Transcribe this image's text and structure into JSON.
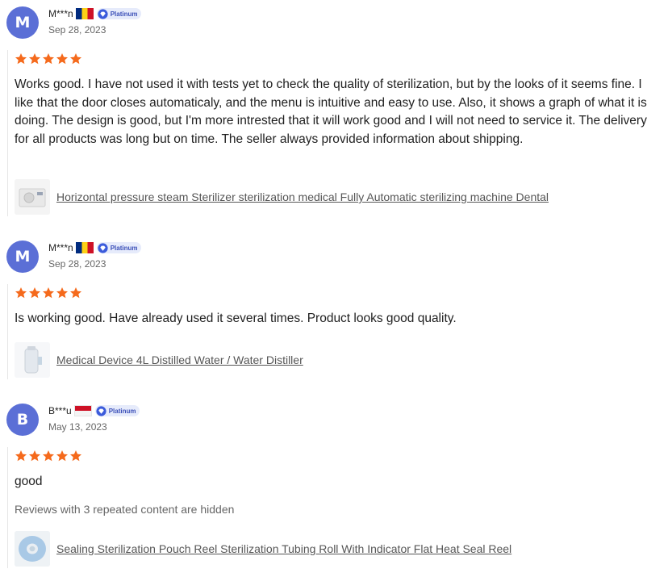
{
  "reviews": [
    {
      "avatar_letter": "M",
      "name": "M***n",
      "country_flag": "romania-flag",
      "badge": "Platinum",
      "date": "Sep 28, 2023",
      "rating": 5,
      "text": "Works good. I have not used it with tests yet to check the quality of sterilization, but by the looks of it seems fine. I like that the door closes automaticaly, and the menu is intuitive and easy to use. Also, it shows a graph of what it is doing. The design is good, but I'm more intrested that it will work good and I will not need to service it. The delivery for all products was long but on time. The seller always provided information about shipping.",
      "product_title": "Horizontal pressure steam Sterilizer sterilization medical Fully Automatic sterilizing machine Dental"
    },
    {
      "avatar_letter": "M",
      "name": "M***n",
      "country_flag": "romania-flag",
      "badge": "Platinum",
      "date": "Sep 28, 2023",
      "rating": 5,
      "text": "Is working good. Have already used it several times. Product looks good quality.",
      "product_title": "Medical Device 4L Distilled Water / Water Distiller"
    },
    {
      "avatar_letter": "B",
      "name": "B***u",
      "country_flag": "indonesia-flag",
      "badge": "Platinum",
      "date": "May 13, 2023",
      "rating": 5,
      "text": "good",
      "hidden_note": "Reviews with 3 repeated content are hidden",
      "product_title": "Sealing Sterilization Pouch Reel Sterilization Tubing Roll With Indicator Flat Heat Seal Reel"
    }
  ],
  "colors": {
    "avatar": "#5b6fd6",
    "star": "#f56a1c",
    "badge_bg": "#e6ebfb",
    "badge_text": "#3b4fb8"
  }
}
